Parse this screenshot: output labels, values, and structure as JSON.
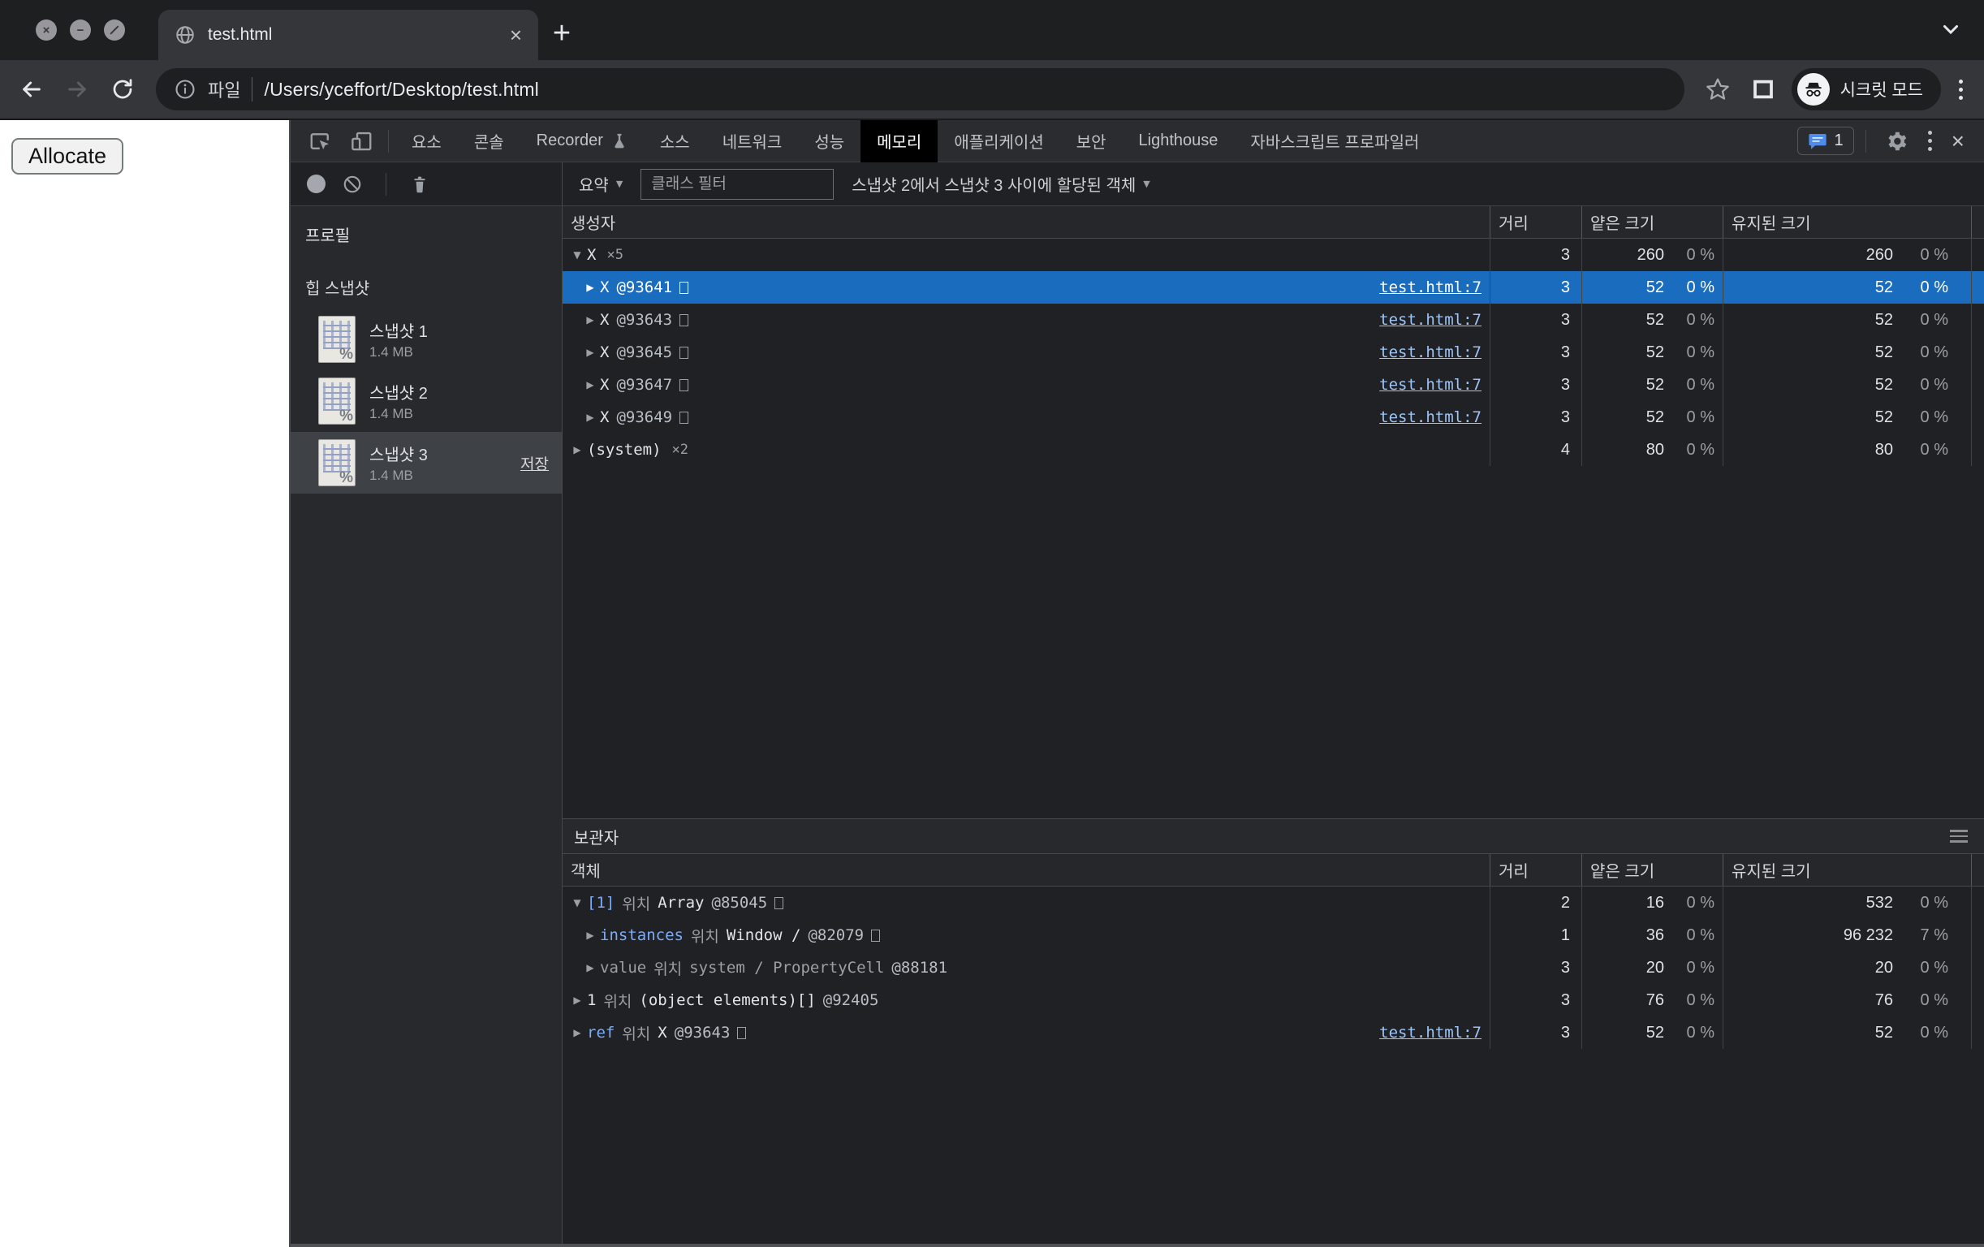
{
  "window": {
    "tab_title": "test.html",
    "url_scheme_label": "파일",
    "url": "/Users/yceffort/Desktop/test.html",
    "incognito_label": "시크릿 모드"
  },
  "page": {
    "allocate_button": "Allocate"
  },
  "devtools": {
    "tabs": [
      {
        "label": "요소"
      },
      {
        "label": "콘솔"
      },
      {
        "label": "Recorder",
        "icon": "flask"
      },
      {
        "label": "소스"
      },
      {
        "label": "네트워크"
      },
      {
        "label": "성능"
      },
      {
        "label": "메모리",
        "selected": true
      },
      {
        "label": "애플리케이션"
      },
      {
        "label": "보안"
      },
      {
        "label": "Lighthouse"
      },
      {
        "label": "자바스크립트 프로파일러"
      }
    ],
    "issues_count": "1",
    "toolbar": {
      "view_mode": "요약",
      "filter_placeholder": "클래스 필터",
      "allocation_range": "스냅샷 2에서 스냅샷 3 사이에 할당된 객체"
    },
    "sidebar": {
      "heading": "프로필",
      "group": "힙 스냅샷",
      "snapshots": [
        {
          "name": "스냅샷 1",
          "size": "1.4 MB",
          "selected": false
        },
        {
          "name": "스냅샷 2",
          "size": "1.4 MB",
          "selected": false
        },
        {
          "name": "스냅샷 3",
          "size": "1.4 MB",
          "selected": true,
          "action": "저장"
        }
      ]
    },
    "constructors": {
      "headers": [
        "생성자",
        "거리",
        "얕은 크기",
        "유지된 크기"
      ],
      "rows": [
        {
          "expand": "open",
          "depth": 0,
          "segments": [
            {
              "text": "X",
              "tone": "bright"
            }
          ],
          "count": "×5",
          "distance": "3",
          "shallow": "260",
          "shallow_pct": "0 %",
          "retained": "260",
          "retained_pct": "0 %"
        },
        {
          "expand": "closed",
          "depth": 1,
          "selected": true,
          "segments": [
            {
              "text": "X",
              "tone": "bright"
            },
            {
              "text": "@93641",
              "tone": "mid"
            },
            {
              "tone": "box"
            }
          ],
          "link": "test.html:7",
          "distance": "3",
          "shallow": "52",
          "shallow_pct": "0 %",
          "retained": "52",
          "retained_pct": "0 %"
        },
        {
          "expand": "closed",
          "depth": 1,
          "segments": [
            {
              "text": "X",
              "tone": "bright"
            },
            {
              "text": "@93643",
              "tone": "mid"
            },
            {
              "tone": "box"
            }
          ],
          "link": "test.html:7",
          "distance": "3",
          "shallow": "52",
          "shallow_pct": "0 %",
          "retained": "52",
          "retained_pct": "0 %"
        },
        {
          "expand": "closed",
          "depth": 1,
          "segments": [
            {
              "text": "X",
              "tone": "bright"
            },
            {
              "text": "@93645",
              "tone": "mid"
            },
            {
              "tone": "box"
            }
          ],
          "link": "test.html:7",
          "distance": "3",
          "shallow": "52",
          "shallow_pct": "0 %",
          "retained": "52",
          "retained_pct": "0 %"
        },
        {
          "expand": "closed",
          "depth": 1,
          "segments": [
            {
              "text": "X",
              "tone": "bright"
            },
            {
              "text": "@93647",
              "tone": "mid"
            },
            {
              "tone": "box"
            }
          ],
          "link": "test.html:7",
          "distance": "3",
          "shallow": "52",
          "shallow_pct": "0 %",
          "retained": "52",
          "retained_pct": "0 %"
        },
        {
          "expand": "closed",
          "depth": 1,
          "segments": [
            {
              "text": "X",
              "tone": "bright"
            },
            {
              "text": "@93649",
              "tone": "mid"
            },
            {
              "tone": "box"
            }
          ],
          "link": "test.html:7",
          "distance": "3",
          "shallow": "52",
          "shallow_pct": "0 %",
          "retained": "52",
          "retained_pct": "0 %"
        },
        {
          "expand": "closed",
          "depth": 0,
          "segments": [
            {
              "text": "(system)",
              "tone": "bright"
            }
          ],
          "count": "×2",
          "distance": "4",
          "shallow": "80",
          "shallow_pct": "0 %",
          "retained": "80",
          "retained_pct": "0 %"
        }
      ]
    },
    "retainers": {
      "title": "보관자",
      "headers": [
        "객체",
        "거리",
        "얕은 크기",
        "유지된 크기"
      ],
      "rows": [
        {
          "expand": "open",
          "depth": 0,
          "segments": [
            {
              "text": "[1]",
              "tone": "blue"
            },
            {
              "text": "위치",
              "tone": "dim"
            },
            {
              "text": "Array",
              "tone": "bright"
            },
            {
              "text": "@85045",
              "tone": "mid"
            },
            {
              "tone": "box"
            }
          ],
          "distance": "2",
          "shallow": "16",
          "shallow_pct": "0 %",
          "retained": "532",
          "retained_pct": "0 %"
        },
        {
          "expand": "closed",
          "depth": 1,
          "segments": [
            {
              "text": "instances",
              "tone": "blue"
            },
            {
              "text": "위치",
              "tone": "dim"
            },
            {
              "text": "Window /",
              "tone": "bright"
            },
            {
              "text": "@82079",
              "tone": "mid"
            },
            {
              "tone": "box"
            }
          ],
          "distance": "1",
          "shallow": "36",
          "shallow_pct": "0 %",
          "retained": "96 232",
          "retained_pct": "7 %"
        },
        {
          "expand": "closed",
          "depth": 1,
          "segments": [
            {
              "text": "value",
              "tone": "dim"
            },
            {
              "text": "위치",
              "tone": "dim"
            },
            {
              "text": "system / PropertyCell",
              "tone": "dim"
            },
            {
              "text": "@88181",
              "tone": "mid"
            }
          ],
          "distance": "3",
          "shallow": "20",
          "shallow_pct": "0 %",
          "retained": "20",
          "retained_pct": "0 %"
        },
        {
          "expand": "closed",
          "depth": 0,
          "segments": [
            {
              "text": "1",
              "tone": "bright"
            },
            {
              "text": "위치",
              "tone": "dim"
            },
            {
              "text": "(object elements)[]",
              "tone": "bright"
            },
            {
              "text": "@92405",
              "tone": "mid"
            }
          ],
          "distance": "3",
          "shallow": "76",
          "shallow_pct": "0 %",
          "retained": "76",
          "retained_pct": "0 %"
        },
        {
          "expand": "closed",
          "depth": 0,
          "segments": [
            {
              "text": "ref",
              "tone": "blue"
            },
            {
              "text": "위치",
              "tone": "dim"
            },
            {
              "text": "X",
              "tone": "bright"
            },
            {
              "text": "@93643",
              "tone": "mid"
            },
            {
              "tone": "box"
            }
          ],
          "link": "test.html:7",
          "distance": "3",
          "shallow": "52",
          "shallow_pct": "0 %",
          "retained": "52",
          "retained_pct": "0 %"
        }
      ]
    },
    "colors": {
      "selection": "#1a6dbe",
      "accent_blue": "#7cacf8",
      "link": "#9ec5f8"
    }
  }
}
